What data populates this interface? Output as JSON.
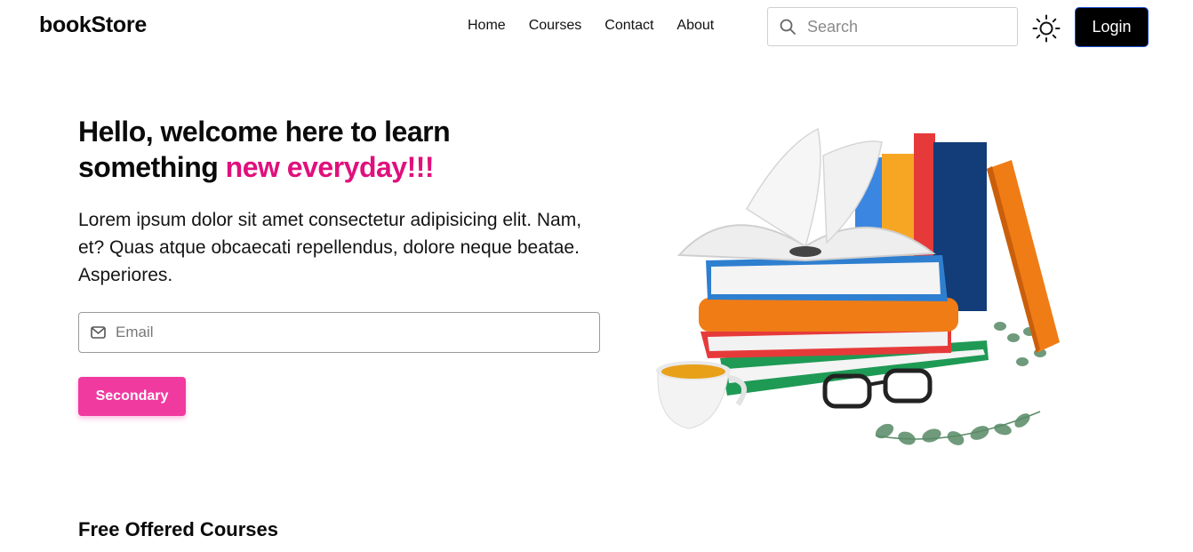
{
  "header": {
    "brand": "bookStore",
    "nav": [
      "Home",
      "Courses",
      "Contact",
      "About"
    ],
    "search_placeholder": "Search",
    "login_label": "Login"
  },
  "hero": {
    "title_line1": "Hello, welcome here to learn",
    "title_line2_start": "something ",
    "title_accent": "new everyday!!!",
    "description": "Lorem ipsum dolor sit amet consectetur adipisicing elit. Nam, et? Quas atque obcaecati repellendus, dolore neque beatae. Asperiores.",
    "email_placeholder": "Email",
    "button_label": "Secondary"
  },
  "section": {
    "title": "Free Offered Courses"
  },
  "colors": {
    "accent": "#e0107c",
    "button": "#f03aa0",
    "login_bg": "#000000"
  },
  "icons": {
    "search": "search-icon",
    "theme": "sun-icon",
    "email": "mail-icon"
  }
}
